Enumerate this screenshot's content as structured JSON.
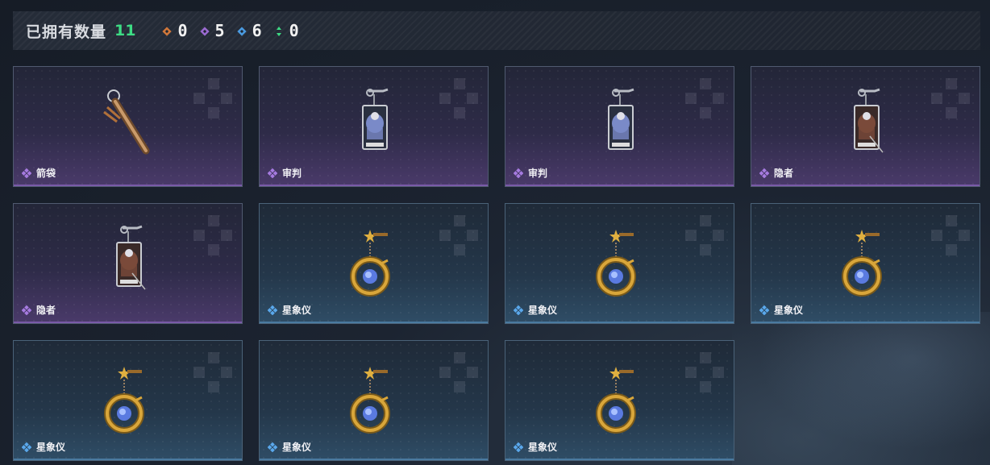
{
  "header": {
    "owned_label": "已拥有数量",
    "owned_count": "11",
    "stats": [
      {
        "icon": "orange-diamond-icon",
        "color": "#d0773a",
        "value": "0"
      },
      {
        "icon": "purple-diamond-icon",
        "color": "#9a6ad0",
        "value": "5"
      },
      {
        "icon": "blue-diamond-icon",
        "color": "#4a9ae0",
        "value": "6"
      },
      {
        "icon": "green-arrows-icon",
        "color": "#3ddc84",
        "value": "0"
      }
    ]
  },
  "items": [
    {
      "name": "箭袋",
      "rarity": "purple",
      "icon": "quiver-charm-icon"
    },
    {
      "name": "审判",
      "rarity": "purple",
      "icon": "judgement-card-icon"
    },
    {
      "name": "审判",
      "rarity": "purple",
      "icon": "judgement-card-icon"
    },
    {
      "name": "隐者",
      "rarity": "purple",
      "icon": "hermit-card-icon"
    },
    {
      "name": "隐者",
      "rarity": "purple",
      "icon": "hermit-card-icon"
    },
    {
      "name": "星象仪",
      "rarity": "blue",
      "icon": "astrolabe-charm-icon"
    },
    {
      "name": "星象仪",
      "rarity": "blue",
      "icon": "astrolabe-charm-icon"
    },
    {
      "name": "星象仪",
      "rarity": "blue",
      "icon": "astrolabe-charm-icon"
    },
    {
      "name": "星象仪",
      "rarity": "blue",
      "icon": "astrolabe-charm-icon"
    },
    {
      "name": "星象仪",
      "rarity": "blue",
      "icon": "astrolabe-charm-icon"
    },
    {
      "name": "星象仪",
      "rarity": "blue",
      "icon": "astrolabe-charm-icon"
    }
  ]
}
